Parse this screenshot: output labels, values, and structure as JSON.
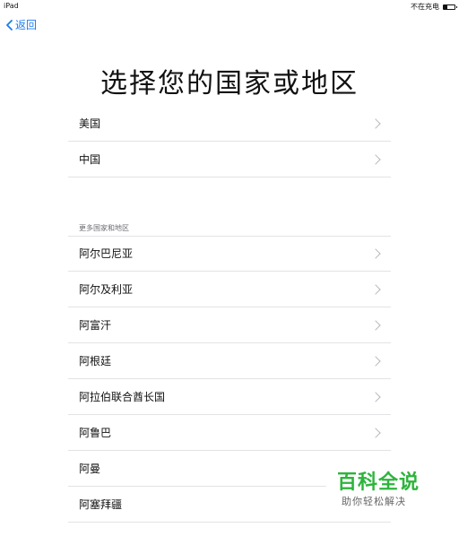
{
  "status_bar": {
    "device": "iPad",
    "charging": "不在充电",
    "battery_level": 0.3
  },
  "nav": {
    "back_label": "返回",
    "accent_color": "#1a7bf2"
  },
  "title": "选择您的国家或地区",
  "top_list": [
    {
      "label": "美国",
      "chevron": true
    },
    {
      "label": "中国",
      "chevron": true
    }
  ],
  "more_section": {
    "header": "更多国家和地区",
    "items": [
      {
        "label": "阿尔巴尼亚",
        "chevron": true
      },
      {
        "label": "阿尔及利亚",
        "chevron": true
      },
      {
        "label": "阿富汗",
        "chevron": true
      },
      {
        "label": "阿根廷",
        "chevron": true
      },
      {
        "label": "阿拉伯联合酋长国",
        "chevron": true
      },
      {
        "label": "阿鲁巴",
        "chevron": true
      },
      {
        "label": "阿曼",
        "chevron": false
      },
      {
        "label": "阿塞拜疆",
        "chevron": false
      }
    ]
  },
  "watermark": {
    "title": "百科全说",
    "subtitle": "助你轻松解决"
  }
}
